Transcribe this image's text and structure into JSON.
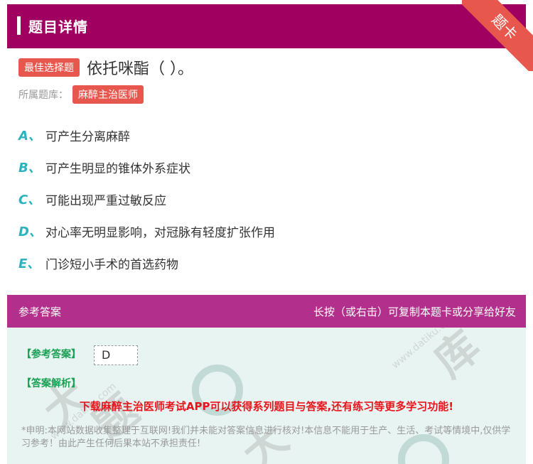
{
  "header": {
    "title": "题目详情",
    "ribbon_label": "题卡"
  },
  "question": {
    "type_tag": "最佳选择题",
    "text": "依托咪酯（ ）。"
  },
  "category": {
    "label": "所属题库：",
    "value": "麻醉主治医师"
  },
  "options": [
    {
      "letter": "A、",
      "text": "可产生分离麻醉"
    },
    {
      "letter": "B、",
      "text": "可产生明显的锥体外系症状"
    },
    {
      "letter": "C、",
      "text": "可能出现严重过敏反应"
    },
    {
      "letter": "D、",
      "text": "对心率无明显影响，对冠脉有轻度扩张作用"
    },
    {
      "letter": "E、",
      "text": "门诊短小手术的首选药物"
    }
  ],
  "answer_bar": {
    "left": "参考答案",
    "right": "长按（或右击）可复制本题卡或分享给好友"
  },
  "answer": {
    "answer_label": "【参考答案】",
    "answer_value": "D",
    "analysis_label": "【答案解析】",
    "promo": "下载麻醉主治医师考试APP可以获得系列题目与答案,还有练习等更多学习功能!",
    "notice": "*申明:本网站数据收集整理于互联网!我们并未能对答案信息进行核对!本信息不能用于生产、生活、考试等情境中,仅供学习参考！由此产生任何后果本站不承担责任!"
  }
}
